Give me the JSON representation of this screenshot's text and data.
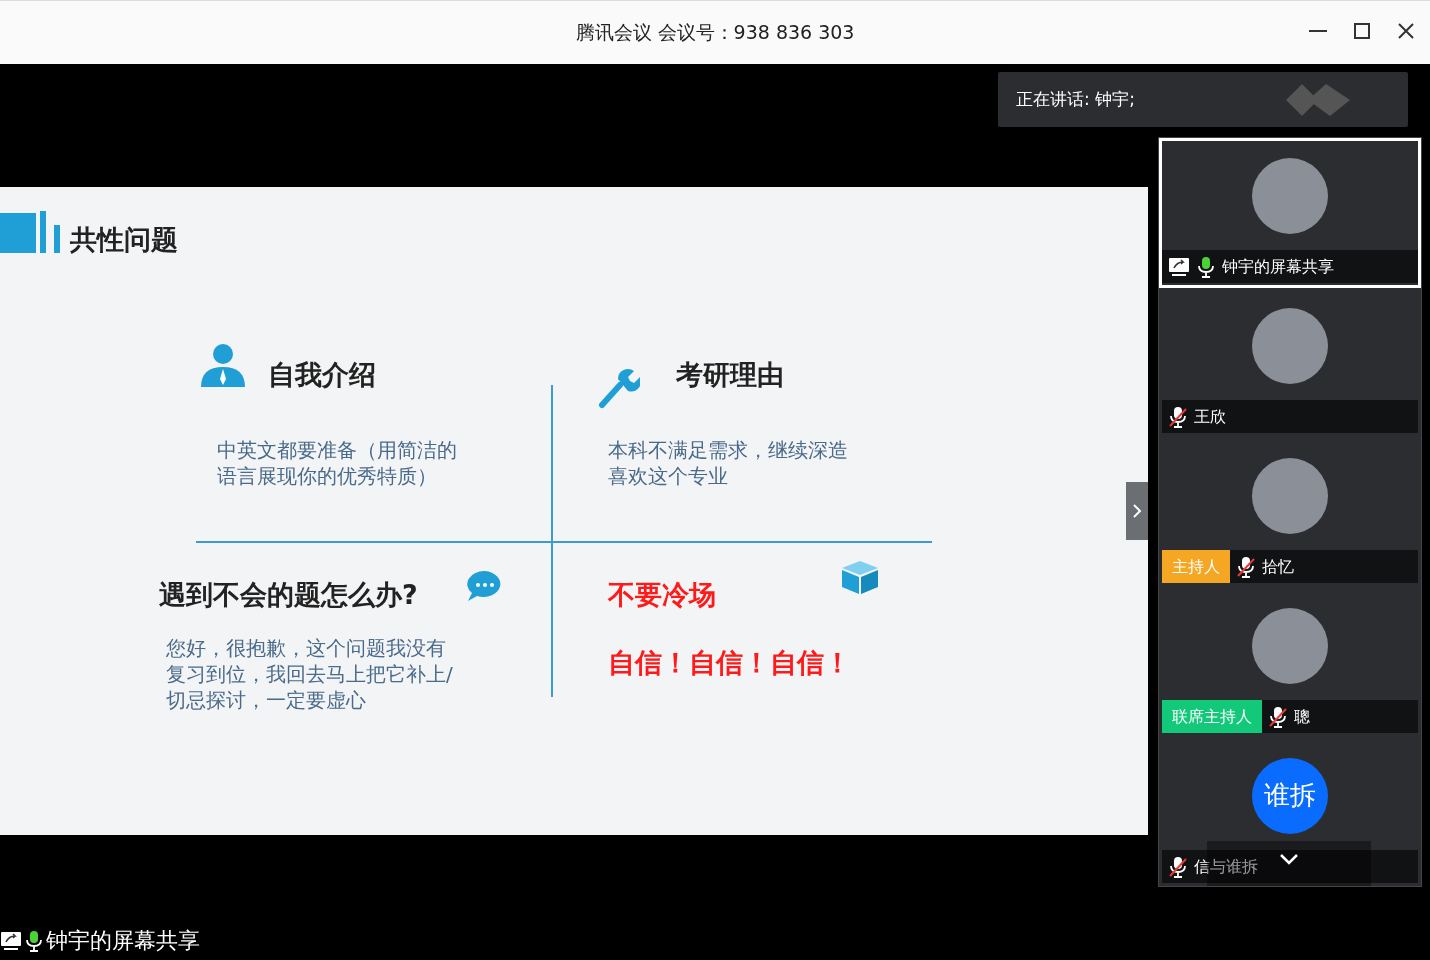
{
  "window": {
    "title": "腾讯会议 会议号：938 836 303"
  },
  "speaking": {
    "label": "正在讲话: 钟宇;"
  },
  "slide": {
    "title": "共性问题",
    "quadrants": [
      {
        "kind": "topic",
        "heading": "自我介绍",
        "lines": [
          "中英文都要准备（用简洁的",
          "语言展现你的优秀特质）"
        ]
      },
      {
        "kind": "topic",
        "heading": "考研理由",
        "lines": [
          "本科不满足需求，继续深造",
          "喜欢这个专业"
        ]
      },
      {
        "kind": "topic",
        "heading": "遇到不会的题怎么办?",
        "lines": [
          "您好，很抱歉，这个问题我没有",
          "复习到位，我回去马上把它补上/",
          "切忌探讨，一定要虚心"
        ]
      },
      {
        "kind": "emphasis",
        "heading": "不要冷场",
        "lines": [
          "自信！自信！自信！"
        ]
      }
    ]
  },
  "participants": [
    {
      "name": "钟宇的屏幕共享",
      "selected": true,
      "sharing": true,
      "muted": false,
      "avatar": {
        "kind": "photo"
      }
    },
    {
      "name": "王欣",
      "selected": false,
      "sharing": false,
      "muted": true,
      "avatar": {
        "kind": "photo"
      }
    },
    {
      "name": "拾忆",
      "selected": false,
      "sharing": false,
      "muted": true,
      "role": {
        "label": "主持人",
        "color": "#f5a623"
      },
      "avatar": {
        "kind": "photo"
      }
    },
    {
      "name": "聰",
      "selected": false,
      "sharing": false,
      "muted": true,
      "role": {
        "label": "联席主持人",
        "color": "#12c97a"
      },
      "avatar": {
        "kind": "photo"
      }
    },
    {
      "name": "信与谁拆",
      "selected": false,
      "sharing": false,
      "muted": true,
      "avatar": {
        "kind": "text",
        "text": "谁拆"
      }
    }
  ],
  "bottom": {
    "label": "钟宇的屏幕共享",
    "sharing": true,
    "muted": false
  }
}
